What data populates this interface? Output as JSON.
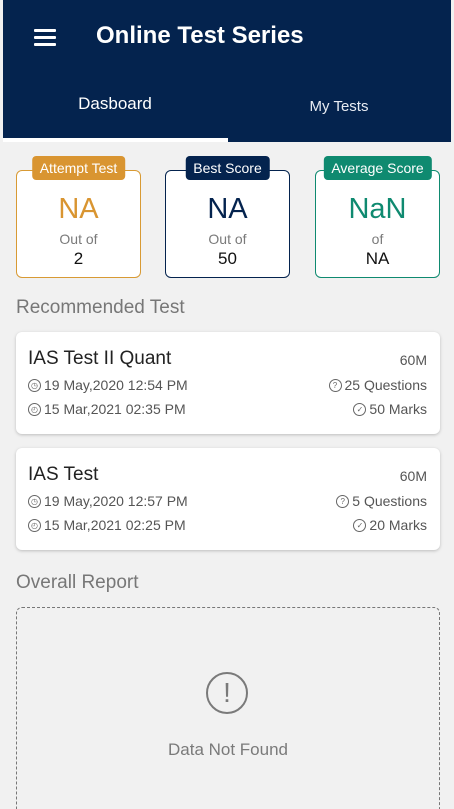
{
  "header": {
    "title": "Online Test Series",
    "menu_icon": "hamburger-menu-icon",
    "bg_color": "#04234e"
  },
  "tabs": [
    {
      "label": "Dasboard",
      "active": true
    },
    {
      "label": "My Tests",
      "active": false
    }
  ],
  "stats": {
    "attempt": {
      "badge": "Attempt Test",
      "value": "NA",
      "sub": "Out of",
      "total": "2",
      "color": "#d99531"
    },
    "best": {
      "badge": "Best Score",
      "value": "NA",
      "sub": "Out of",
      "total": "50",
      "color": "#04234e"
    },
    "average": {
      "badge": "Average Score",
      "value": "NaN",
      "sub": "of",
      "total": "NA",
      "color": "#0f8a70"
    }
  },
  "recommended": {
    "title": "Recommended Test",
    "tests": [
      {
        "name": "IAS Test II Quant",
        "duration": "60M",
        "start": "19 May,2020 12:54 PM",
        "end": "15 Mar,2021 02:35 PM",
        "questions": "25 Questions",
        "marks": "50 Marks"
      },
      {
        "name": "IAS Test",
        "duration": "60M",
        "start": "19 May,2020 12:57 PM",
        "end": "15 Mar,2021 02:25 PM",
        "questions": "5 Questions",
        "marks": "20 Marks"
      }
    ]
  },
  "report": {
    "title": "Overall Report",
    "empty_icon": "exclamation-circle-icon",
    "empty_text": "Data Not Found"
  }
}
